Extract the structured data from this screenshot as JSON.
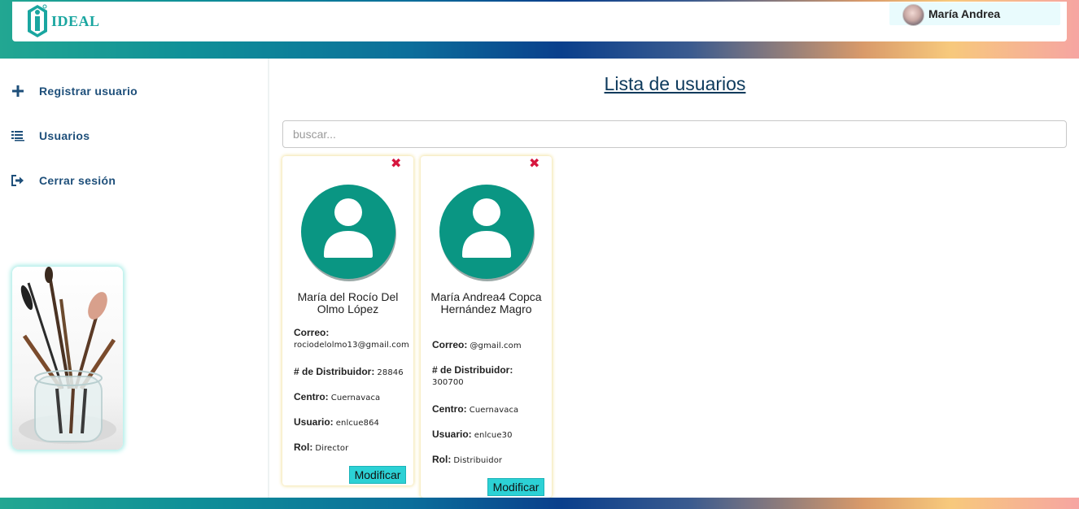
{
  "header": {
    "brand": "IDEAL",
    "user_name": "María Andrea"
  },
  "sidebar": {
    "items": [
      {
        "label": "Registrar usuario",
        "icon": "plus-icon"
      },
      {
        "label": "Usuarios",
        "icon": "list-icon"
      },
      {
        "label": "Cerrar sesión",
        "icon": "sign-out-icon"
      }
    ]
  },
  "main": {
    "title": "Lista de usuarios",
    "search_placeholder": "buscar..."
  },
  "users": [
    {
      "name": "María del Rocío Del Olmo López",
      "correo_label": "Correo:",
      "correo": "rociodelolmo13@gmail.com",
      "distribuidor_label": "# de Distribuidor:",
      "distribuidor": "28846",
      "centro_label": "Centro:",
      "centro": "Cuernavaca",
      "usuario_label": "Usuario:",
      "usuario": "enlcue864",
      "rol_label": "Rol:",
      "rol": "Director",
      "button": "Modificar"
    },
    {
      "name": "María Andrea4 Copca Hernández Magro",
      "correo_label": "Correo:",
      "correo": "@gmail.com",
      "distribuidor_label": "# de Distribuidor:",
      "distribuidor": "300700",
      "centro_label": "Centro:",
      "centro": "Cuernavaca",
      "usuario_label": "Usuario:",
      "usuario": "enlcue30",
      "rol_label": "Rol:",
      "rol": "Distribuidor",
      "button": "Modificar"
    }
  ],
  "colors": {
    "accent": "#0a9683",
    "button": "#2cd1d5",
    "delete": "#d6163e",
    "nav_text": "#1e4f7a"
  }
}
